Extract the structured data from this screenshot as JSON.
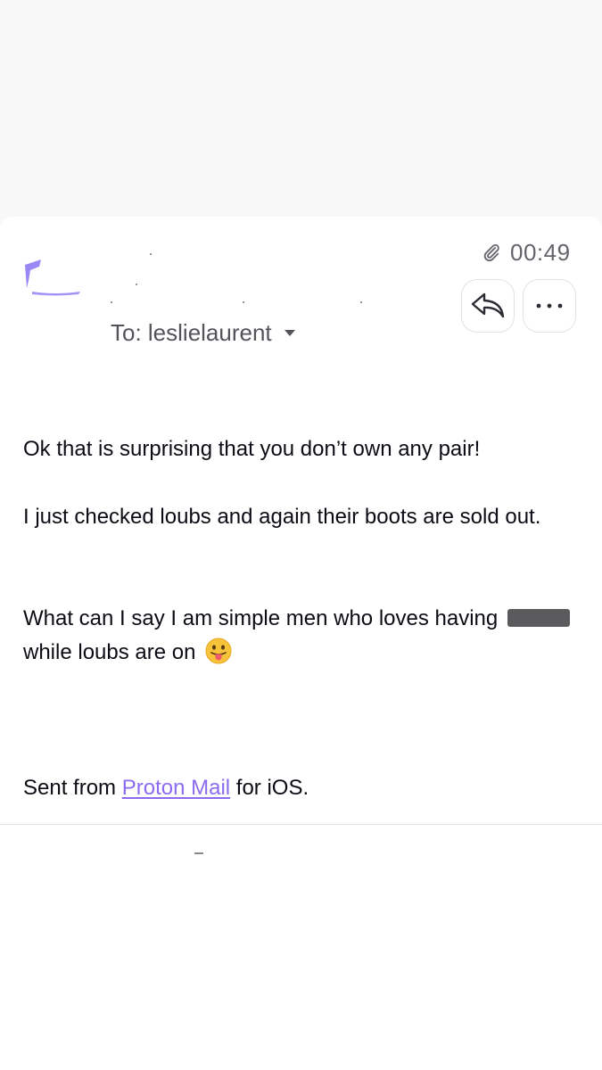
{
  "header": {
    "time": "00:49",
    "attachment_icon": "paperclip-icon",
    "to_label": "To: leslielaurent",
    "reply_icon": "reply-icon",
    "more_icon": "more-dots-icon",
    "accent_color": "#8b6cf0"
  },
  "message": {
    "paragraph_1": "Ok that is surprising that you don’t own any pair!",
    "paragraph_2": "I just checked loubs and again their boots are sold out.",
    "paragraph_3_before": "What can I say I am simple men who loves having",
    "paragraph_3_after": "while loubs are on",
    "emoji_icon": "tongue-out-emoji-icon",
    "signature_prefix": "Sent from ",
    "signature_link": "Proton Mail",
    "signature_suffix": " for iOS."
  }
}
